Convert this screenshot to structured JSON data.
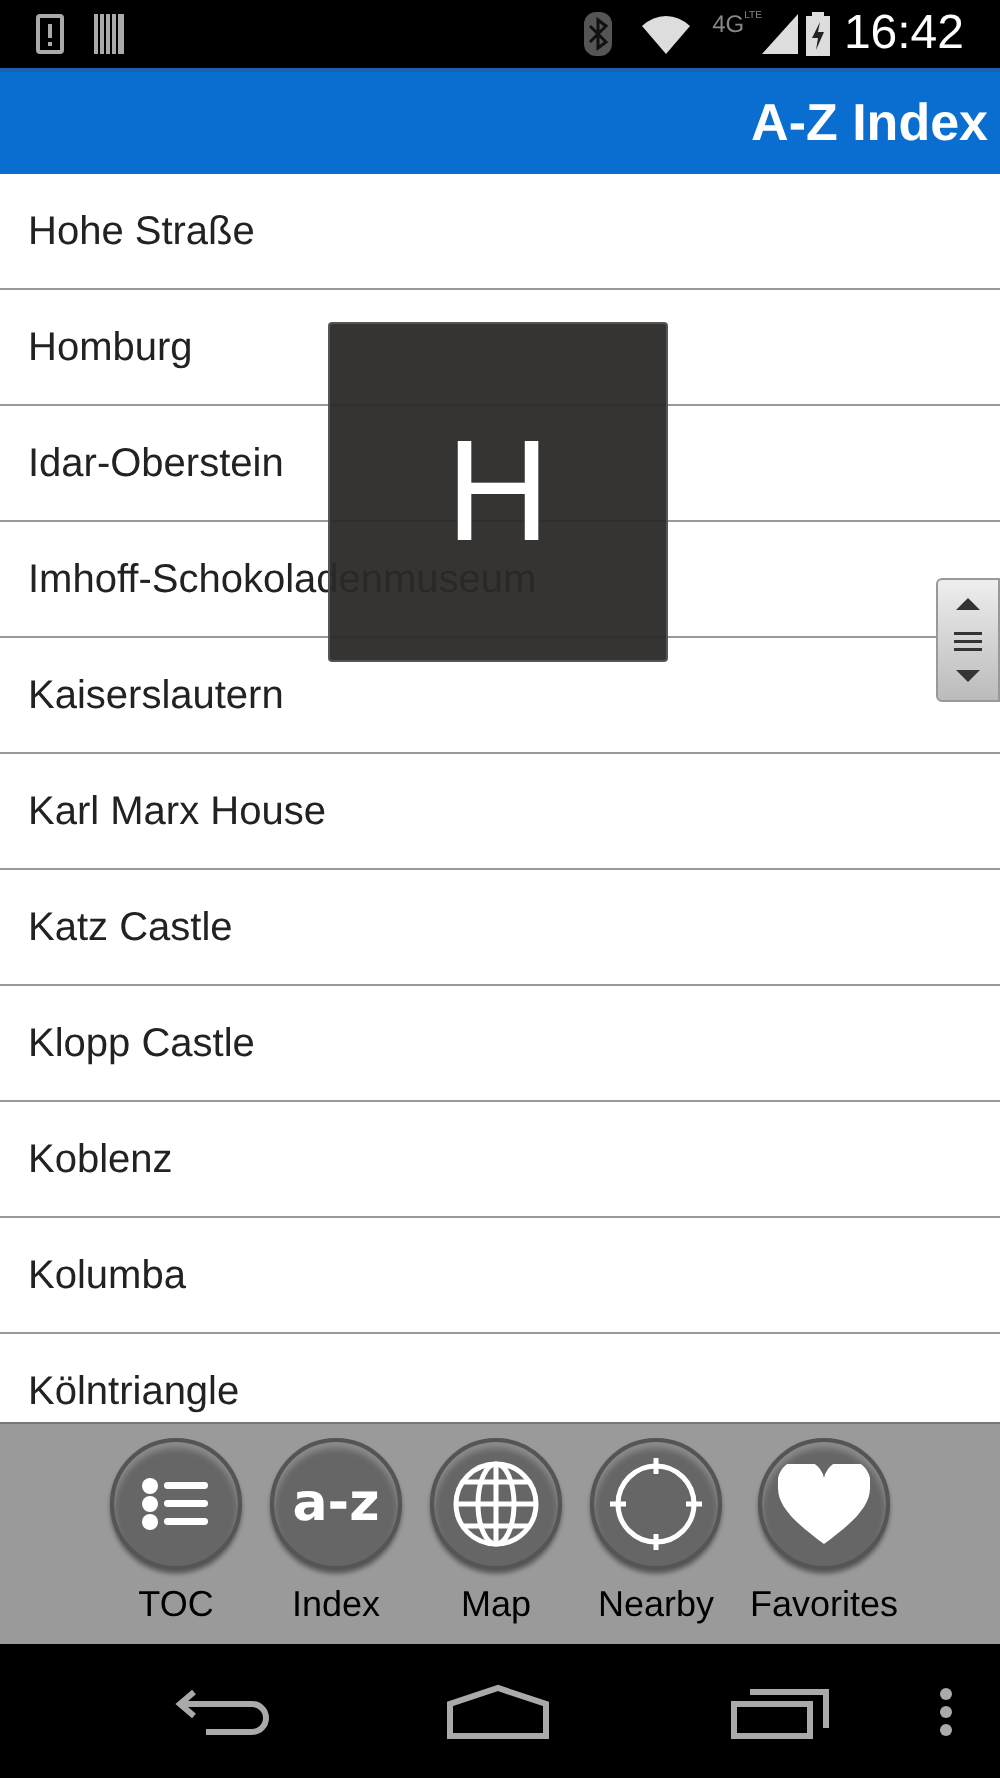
{
  "status_bar": {
    "network": "4G",
    "network_sub": "LTE",
    "time": "16:42"
  },
  "header": {
    "title": "A-Z Index"
  },
  "list": {
    "items": [
      "Hohe Straße",
      "Homburg",
      "Idar-Oberstein",
      "Imhoff-Schokoladenmuseum",
      "Kaiserslautern",
      "Karl Marx House",
      "Katz Castle",
      "Klopp Castle",
      "Koblenz",
      "Kolumba",
      "Kölntriangle"
    ]
  },
  "section_overlay": {
    "letter": "H"
  },
  "toolbar": [
    {
      "kind": "list",
      "label": "TOC"
    },
    {
      "kind": "az",
      "label": "Index",
      "glyph": "a-z"
    },
    {
      "kind": "globe",
      "label": "Map"
    },
    {
      "kind": "crosshair",
      "label": "Nearby"
    },
    {
      "kind": "heart",
      "label": "Favorites"
    }
  ]
}
